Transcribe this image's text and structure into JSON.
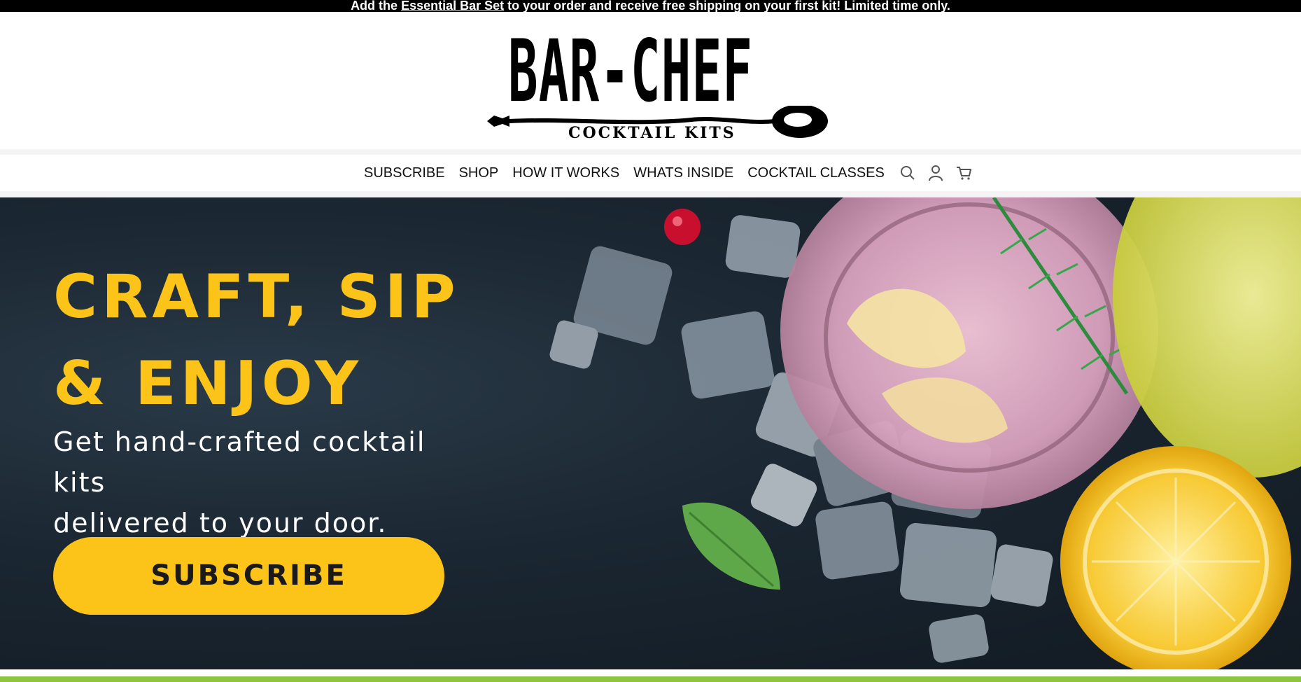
{
  "announcement": {
    "prefix": "Add the",
    "link": "Essential Bar Set",
    "suffix": " to your order and receive free shipping on your first kit! Limited time only."
  },
  "logo": {
    "wordmark": "BAR-CHEF",
    "tagline": "COCKTAIL KITS"
  },
  "nav": {
    "items": [
      {
        "label": "SUBSCRIBE"
      },
      {
        "label": "SHOP"
      },
      {
        "label": "HOW IT WORKS"
      },
      {
        "label": "WHATS INSIDE"
      },
      {
        "label": "COCKTAIL CLASSES"
      }
    ],
    "icons": [
      "search-icon",
      "account-icon",
      "cart-icon"
    ]
  },
  "hero": {
    "title_line1": "CRAFT, SIP",
    "title_line2": "& ENJOY",
    "subtitle_line1": "Get hand-crafted cocktail kits",
    "subtitle_line2": "delivered to your door.",
    "cta_label": "SUBSCRIBE"
  },
  "colors": {
    "accent_yellow": "#fcc419",
    "green_bar": "#8cc63f",
    "announce_bg": "#000000"
  }
}
